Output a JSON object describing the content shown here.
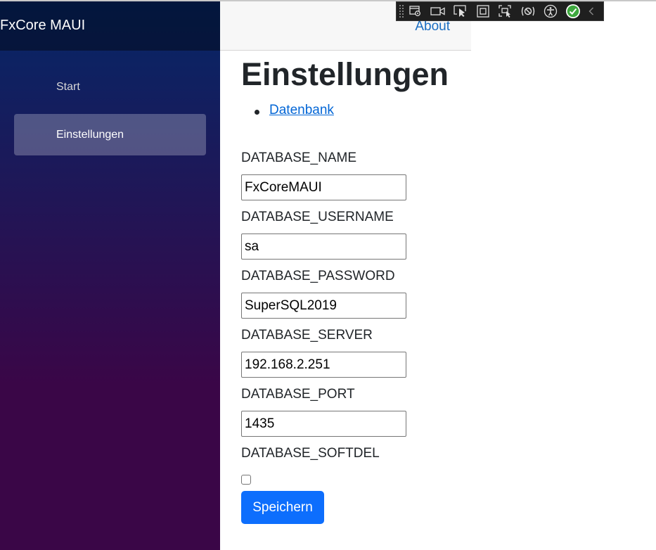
{
  "app": {
    "title": "FxCore MAUI"
  },
  "sidebar": {
    "items": [
      {
        "label": "Start",
        "active": false
      },
      {
        "label": "Einstellungen",
        "active": true
      }
    ]
  },
  "top_row": {
    "about_label": "About"
  },
  "page": {
    "title": "Einstellungen",
    "sections": [
      {
        "label": "Datenbank"
      }
    ]
  },
  "form": {
    "fields": [
      {
        "label": "DATABASE_NAME",
        "value": "FxCoreMAUI"
      },
      {
        "label": "DATABASE_USERNAME",
        "value": "sa"
      },
      {
        "label": "DATABASE_PASSWORD",
        "value": "SuperSQL2019"
      },
      {
        "label": "DATABASE_SERVER",
        "value": "192.168.2.251"
      },
      {
        "label": "DATABASE_PORT",
        "value": "1435"
      }
    ],
    "softdel": {
      "label": "DATABASE_SOFTDEL",
      "checked": false
    },
    "save_label": "Speichern"
  },
  "dev_toolbar": {
    "icons": [
      "grip-icon",
      "live-visual-tree-icon",
      "video-camera-icon",
      "select-element-icon",
      "display-layout-adorners-icon",
      "track-focus-icon",
      "hot-reload-icon",
      "accessibility-icon",
      "check-circle-icon",
      "collapse-chevron-icon"
    ]
  },
  "colors": {
    "sidebar_top": "#052767",
    "sidebar_bottom": "#3a0647",
    "link": "#1b6ec2",
    "primary_button": "#0d6efd"
  }
}
